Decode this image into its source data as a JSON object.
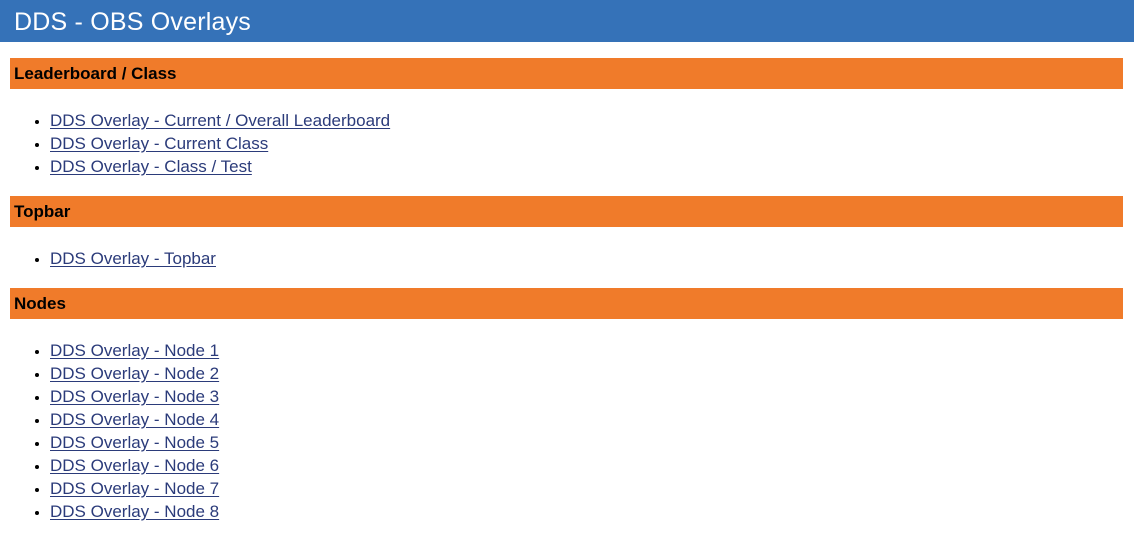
{
  "header": {
    "title": "DDS - OBS Overlays"
  },
  "sections": [
    {
      "heading": "Leaderboard / Class",
      "links": [
        "DDS Overlay - Current / Overall Leaderboard",
        "DDS Overlay - Current Class",
        "DDS Overlay - Class / Test"
      ]
    },
    {
      "heading": "Topbar",
      "links": [
        "DDS Overlay - Topbar"
      ]
    },
    {
      "heading": "Nodes",
      "links": [
        "DDS Overlay - Node 1",
        "DDS Overlay - Node 2",
        "DDS Overlay - Node 3",
        "DDS Overlay - Node 4",
        "DDS Overlay - Node 5",
        "DDS Overlay - Node 6",
        "DDS Overlay - Node 7",
        "DDS Overlay - Node 8"
      ]
    }
  ],
  "colors": {
    "header_bg": "#3572b8",
    "section_bg": "#f07b2a",
    "link": "#2b3b7a"
  }
}
